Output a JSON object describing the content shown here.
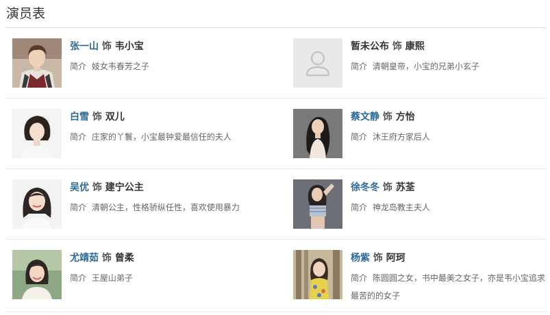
{
  "section": {
    "title": "演员表"
  },
  "cast": [
    {
      "actor": "张一山",
      "plays": "饰",
      "role": "韦小宝",
      "desc_label": "简介",
      "desc": "妓女韦春芳之子",
      "photo": "actor-photo",
      "photo_tone": "#8a6a58"
    },
    {
      "actor": "暂未公布",
      "plays": "饰",
      "role": "康熙",
      "desc_label": "简介",
      "desc": "清朝皇帝，小宝的兄弟小玄子",
      "photo": "person-placeholder-icon",
      "photo_tone": "#e9e9e9"
    },
    {
      "actor": "白雪",
      "plays": "饰",
      "role": "双儿",
      "desc_label": "简介",
      "desc": "庄家的丫鬟，小宝最钟爱最信任的夫人",
      "photo": "actor-photo",
      "photo_tone": "#f2f2f2"
    },
    {
      "actor": "蔡文静",
      "plays": "饰",
      "role": "方怡",
      "desc_label": "简介",
      "desc": "沐王府方家后人",
      "photo": "actor-photo",
      "photo_tone": "#6c6c6c"
    },
    {
      "actor": "吴优",
      "plays": "饰",
      "role": "建宁公主",
      "desc_label": "简介",
      "desc": "清朝公主，性格骄纵任性，喜欢使用暴力",
      "photo": "actor-photo",
      "photo_tone": "#f3f3f3"
    },
    {
      "actor": "徐冬冬",
      "plays": "饰",
      "role": "苏荃",
      "desc_label": "简介",
      "desc": "神龙岛教主夫人",
      "photo": "actor-photo",
      "photo_tone": "#6e7078"
    },
    {
      "actor": "尤靖茹",
      "plays": "饰",
      "role": "曾柔",
      "desc_label": "简介",
      "desc": "王屋山弟子",
      "photo": "actor-photo",
      "photo_tone": "#7e9a6e"
    },
    {
      "actor": "杨紫",
      "plays": "饰",
      "role": "阿珂",
      "desc_label": "简介",
      "desc": "陈圆圆之女，书中最美之女子，亦是韦小宝追求最苦的的女子",
      "photo": "actor-photo",
      "photo_tone": "#b3a489"
    }
  ],
  "colors": {
    "actor_link": "#2b6a98",
    "text": "#333333",
    "muted": "#666666",
    "divider": "#e8e8e8"
  }
}
